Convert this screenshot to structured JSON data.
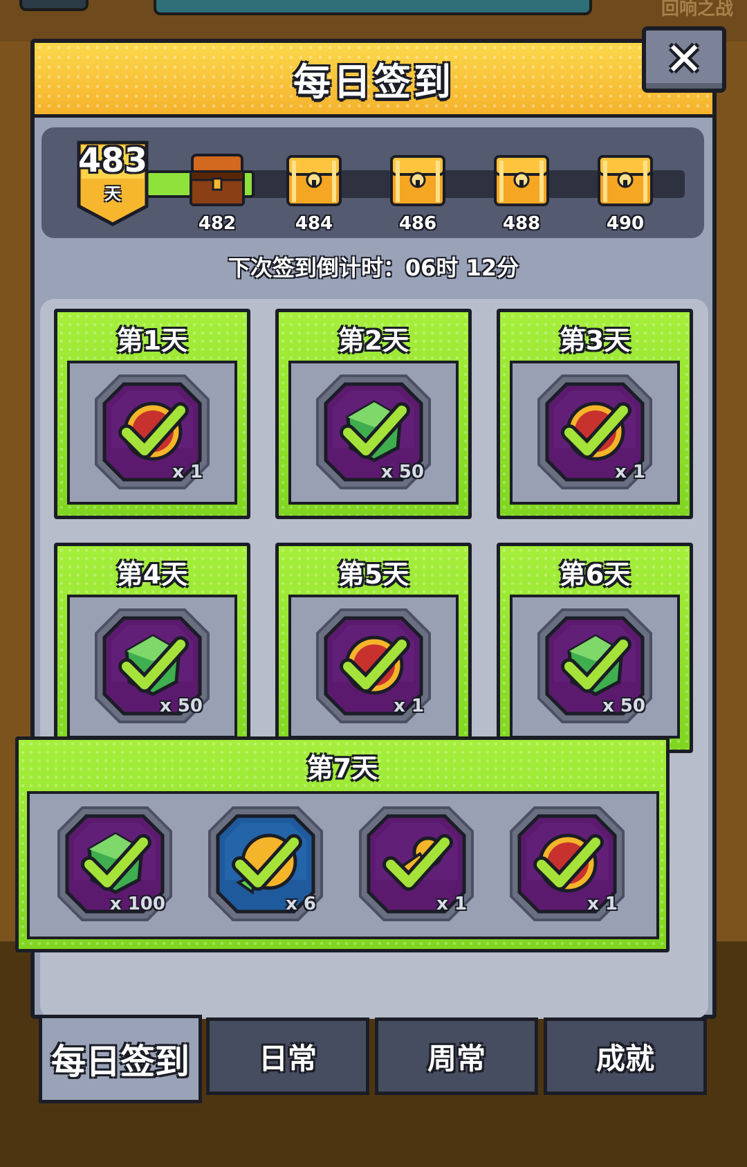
{
  "background": {
    "faint_text": "回响之战"
  },
  "header": {
    "title": "每日签到",
    "close_label": "✕"
  },
  "progress": {
    "current_days": "483",
    "days_unit": "天",
    "milestones": [
      {
        "day": "482",
        "icon": "chest-opened-icon"
      },
      {
        "day": "484",
        "icon": "chest-gold-icon"
      },
      {
        "day": "486",
        "icon": "chest-gold-icon"
      },
      {
        "day": "488",
        "icon": "chest-gold-icon"
      },
      {
        "day": "490",
        "icon": "chest-gold-icon"
      }
    ]
  },
  "countdown": {
    "text": "下次签到倒计时：06时 12分"
  },
  "days": [
    {
      "title": "第1天",
      "rewards": [
        {
          "icon": "medal-icon",
          "qty": "x 1",
          "claimed": true
        }
      ]
    },
    {
      "title": "第2天",
      "rewards": [
        {
          "icon": "gem-icon",
          "qty": "x 50",
          "claimed": true
        }
      ]
    },
    {
      "title": "第3天",
      "rewards": [
        {
          "icon": "medal-icon",
          "qty": "x 1",
          "claimed": true
        }
      ]
    },
    {
      "title": "第4天",
      "rewards": [
        {
          "icon": "gem-icon",
          "qty": "x 50",
          "claimed": true
        }
      ]
    },
    {
      "title": "第5天",
      "rewards": [
        {
          "icon": "medal-icon",
          "qty": "x 1",
          "claimed": true
        }
      ]
    },
    {
      "title": "第6天",
      "rewards": [
        {
          "icon": "gem-icon",
          "qty": "x 50",
          "claimed": true
        }
      ]
    },
    {
      "title": "第7天",
      "rewards": [
        {
          "icon": "gem-icon",
          "qty": "x 100",
          "claimed": true
        },
        {
          "icon": "refresh-coin-icon",
          "qty": "x 6",
          "claimed": true
        },
        {
          "icon": "key-icon",
          "qty": "x 1",
          "claimed": true
        },
        {
          "icon": "medal-icon",
          "qty": "x 1",
          "claimed": true
        }
      ]
    }
  ],
  "tabs": [
    {
      "label": "每日签到",
      "active": true
    },
    {
      "label": "日常",
      "active": false
    },
    {
      "label": "周常",
      "active": false
    },
    {
      "label": "成就",
      "active": false
    }
  ],
  "colors": {
    "accent_green": "#8ede2e",
    "header_yellow": "#f6b72f",
    "panel_gray": "#9aa2b8",
    "item_purple": "#5b1a6e",
    "item_blue": "#1f5a9c",
    "outline": "#1b1d26"
  }
}
